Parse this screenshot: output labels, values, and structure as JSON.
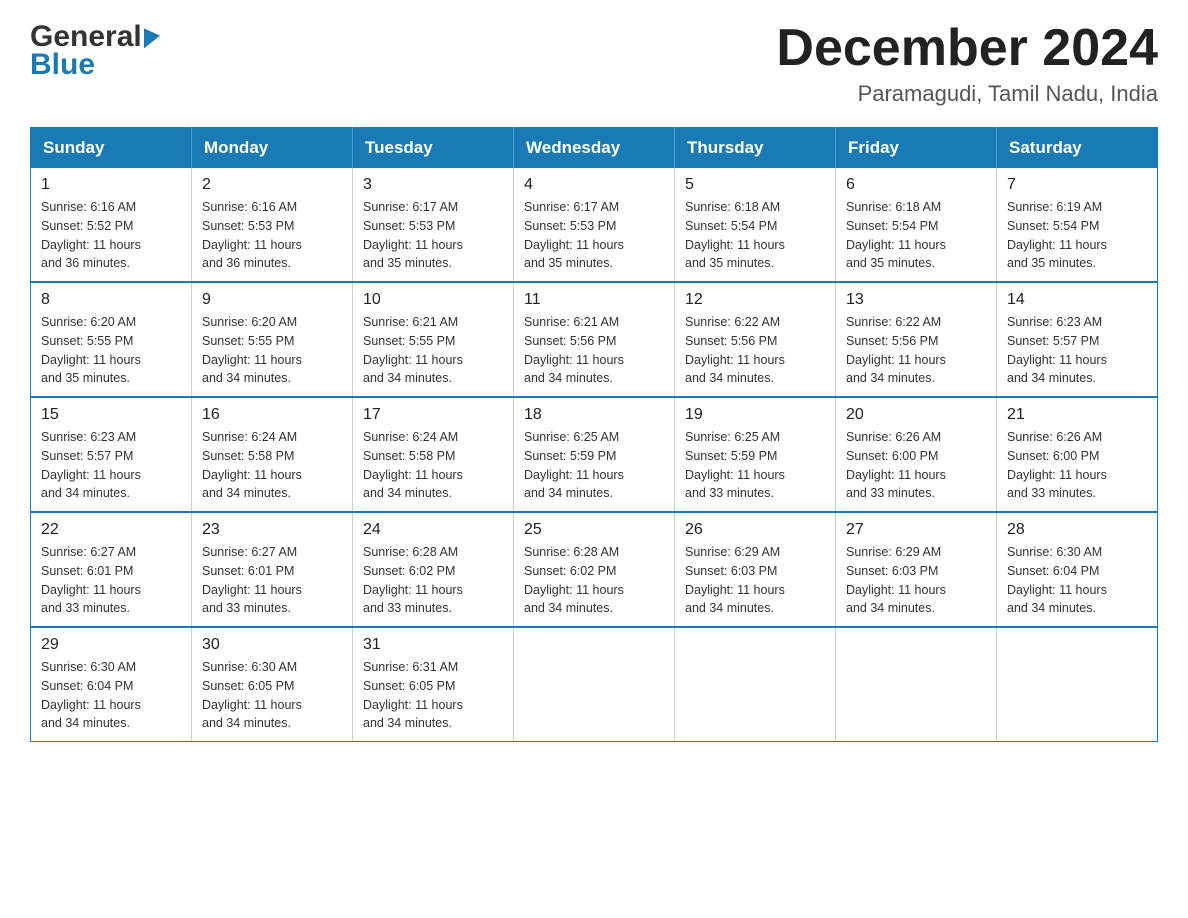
{
  "header": {
    "logo_general": "General",
    "logo_blue": "Blue",
    "month_year": "December 2024",
    "location": "Paramagudi, Tamil Nadu, India"
  },
  "days_of_week": [
    "Sunday",
    "Monday",
    "Tuesday",
    "Wednesday",
    "Thursday",
    "Friday",
    "Saturday"
  ],
  "weeks": [
    [
      {
        "day": "1",
        "sunrise": "6:16 AM",
        "sunset": "5:52 PM",
        "daylight": "11 hours and 36 minutes."
      },
      {
        "day": "2",
        "sunrise": "6:16 AM",
        "sunset": "5:53 PM",
        "daylight": "11 hours and 36 minutes."
      },
      {
        "day": "3",
        "sunrise": "6:17 AM",
        "sunset": "5:53 PM",
        "daylight": "11 hours and 35 minutes."
      },
      {
        "day": "4",
        "sunrise": "6:17 AM",
        "sunset": "5:53 PM",
        "daylight": "11 hours and 35 minutes."
      },
      {
        "day": "5",
        "sunrise": "6:18 AM",
        "sunset": "5:54 PM",
        "daylight": "11 hours and 35 minutes."
      },
      {
        "day": "6",
        "sunrise": "6:18 AM",
        "sunset": "5:54 PM",
        "daylight": "11 hours and 35 minutes."
      },
      {
        "day": "7",
        "sunrise": "6:19 AM",
        "sunset": "5:54 PM",
        "daylight": "11 hours and 35 minutes."
      }
    ],
    [
      {
        "day": "8",
        "sunrise": "6:20 AM",
        "sunset": "5:55 PM",
        "daylight": "11 hours and 35 minutes."
      },
      {
        "day": "9",
        "sunrise": "6:20 AM",
        "sunset": "5:55 PM",
        "daylight": "11 hours and 34 minutes."
      },
      {
        "day": "10",
        "sunrise": "6:21 AM",
        "sunset": "5:55 PM",
        "daylight": "11 hours and 34 minutes."
      },
      {
        "day": "11",
        "sunrise": "6:21 AM",
        "sunset": "5:56 PM",
        "daylight": "11 hours and 34 minutes."
      },
      {
        "day": "12",
        "sunrise": "6:22 AM",
        "sunset": "5:56 PM",
        "daylight": "11 hours and 34 minutes."
      },
      {
        "day": "13",
        "sunrise": "6:22 AM",
        "sunset": "5:56 PM",
        "daylight": "11 hours and 34 minutes."
      },
      {
        "day": "14",
        "sunrise": "6:23 AM",
        "sunset": "5:57 PM",
        "daylight": "11 hours and 34 minutes."
      }
    ],
    [
      {
        "day": "15",
        "sunrise": "6:23 AM",
        "sunset": "5:57 PM",
        "daylight": "11 hours and 34 minutes."
      },
      {
        "day": "16",
        "sunrise": "6:24 AM",
        "sunset": "5:58 PM",
        "daylight": "11 hours and 34 minutes."
      },
      {
        "day": "17",
        "sunrise": "6:24 AM",
        "sunset": "5:58 PM",
        "daylight": "11 hours and 34 minutes."
      },
      {
        "day": "18",
        "sunrise": "6:25 AM",
        "sunset": "5:59 PM",
        "daylight": "11 hours and 34 minutes."
      },
      {
        "day": "19",
        "sunrise": "6:25 AM",
        "sunset": "5:59 PM",
        "daylight": "11 hours and 33 minutes."
      },
      {
        "day": "20",
        "sunrise": "6:26 AM",
        "sunset": "6:00 PM",
        "daylight": "11 hours and 33 minutes."
      },
      {
        "day": "21",
        "sunrise": "6:26 AM",
        "sunset": "6:00 PM",
        "daylight": "11 hours and 33 minutes."
      }
    ],
    [
      {
        "day": "22",
        "sunrise": "6:27 AM",
        "sunset": "6:01 PM",
        "daylight": "11 hours and 33 minutes."
      },
      {
        "day": "23",
        "sunrise": "6:27 AM",
        "sunset": "6:01 PM",
        "daylight": "11 hours and 33 minutes."
      },
      {
        "day": "24",
        "sunrise": "6:28 AM",
        "sunset": "6:02 PM",
        "daylight": "11 hours and 33 minutes."
      },
      {
        "day": "25",
        "sunrise": "6:28 AM",
        "sunset": "6:02 PM",
        "daylight": "11 hours and 34 minutes."
      },
      {
        "day": "26",
        "sunrise": "6:29 AM",
        "sunset": "6:03 PM",
        "daylight": "11 hours and 34 minutes."
      },
      {
        "day": "27",
        "sunrise": "6:29 AM",
        "sunset": "6:03 PM",
        "daylight": "11 hours and 34 minutes."
      },
      {
        "day": "28",
        "sunrise": "6:30 AM",
        "sunset": "6:04 PM",
        "daylight": "11 hours and 34 minutes."
      }
    ],
    [
      {
        "day": "29",
        "sunrise": "6:30 AM",
        "sunset": "6:04 PM",
        "daylight": "11 hours and 34 minutes."
      },
      {
        "day": "30",
        "sunrise": "6:30 AM",
        "sunset": "6:05 PM",
        "daylight": "11 hours and 34 minutes."
      },
      {
        "day": "31",
        "sunrise": "6:31 AM",
        "sunset": "6:05 PM",
        "daylight": "11 hours and 34 minutes."
      },
      null,
      null,
      null,
      null
    ]
  ],
  "labels": {
    "sunrise": "Sunrise:",
    "sunset": "Sunset:",
    "daylight": "Daylight:"
  }
}
